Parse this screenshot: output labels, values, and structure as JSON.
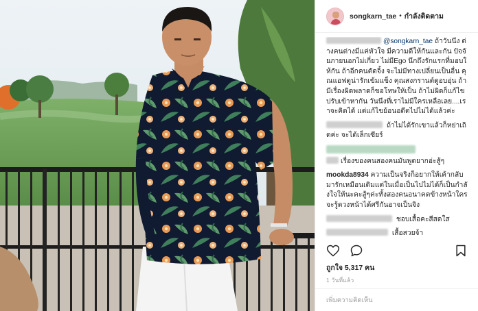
{
  "post": {
    "username": "songkarn_tae",
    "follow_status": "กำลังติดตาม",
    "likes_label": "ถูกใจ 5,317 คน",
    "time_label": "1 วันที่แล้ว",
    "add_comment_placeholder": "เพิ่มความคิดเห็น"
  },
  "comments": [
    {
      "mention": "@songkarn_tae",
      "text": " ถ้าวันนึง ต่างคนต่างมีแค่หัวใจ มีความดีให้กันและกัน ปัจจัยภายนอกไม่เกี่ยว ไม่มีEgo นึกถึงรักแรกที่มอบให้กัน ถ้าอีกคนตัดจิ้ง จะไม่มีทางเปลี่ยนเป็นอื่น คุณแอฟดูน่ารักเข้มแข็ง คุณสงกรานต์ดูอบอุ่น ถ้ามีเรื่องผิดพลาดก็ขอโทษให้เป็น ถ้าไม่ผิดก็แก้ไขปรับเข้าหากัน วันนึงที่เราไม่มีใครเหลือเลย....เราจะคิดได้ แต่แก้ไขย้อนอดีตไปไม่ได้แล้วค่ะ"
    },
    {
      "text": " ถ้าไม่ได้รักเขาแล้วก็หย่าเถิดค่ะ จะได้เล็กเซียร์"
    },
    {
      "text": "เรื่องของคนสองคนมันพูดยากอ่ะสู้ๆ"
    },
    {
      "user": "mookda8934",
      "text": " ความเป็นจริงก็อยากให้เค้ากลับมารักเหมือนเดิมแต่ในเมื่อเป็นไปไม่ได้ก็เป็นกำลังใจให้นะคะสู้ๆค่ะทั้งสองคนอนาคตข้างหน้าใครจะรู้ดวงหน้าได้ศรีกันอาจเป็นจิง"
    },
    {
      "text": " ชอบเสื้อคะสีสดใส"
    },
    {
      "text": " เสื้อสวยจ้า"
    }
  ],
  "icons": {
    "like": "heart-icon",
    "comment": "comment-icon",
    "save": "bookmark-icon"
  },
  "colors": {
    "text": "#262626",
    "muted": "#999999",
    "mention": "#003569",
    "border": "#efefef"
  }
}
